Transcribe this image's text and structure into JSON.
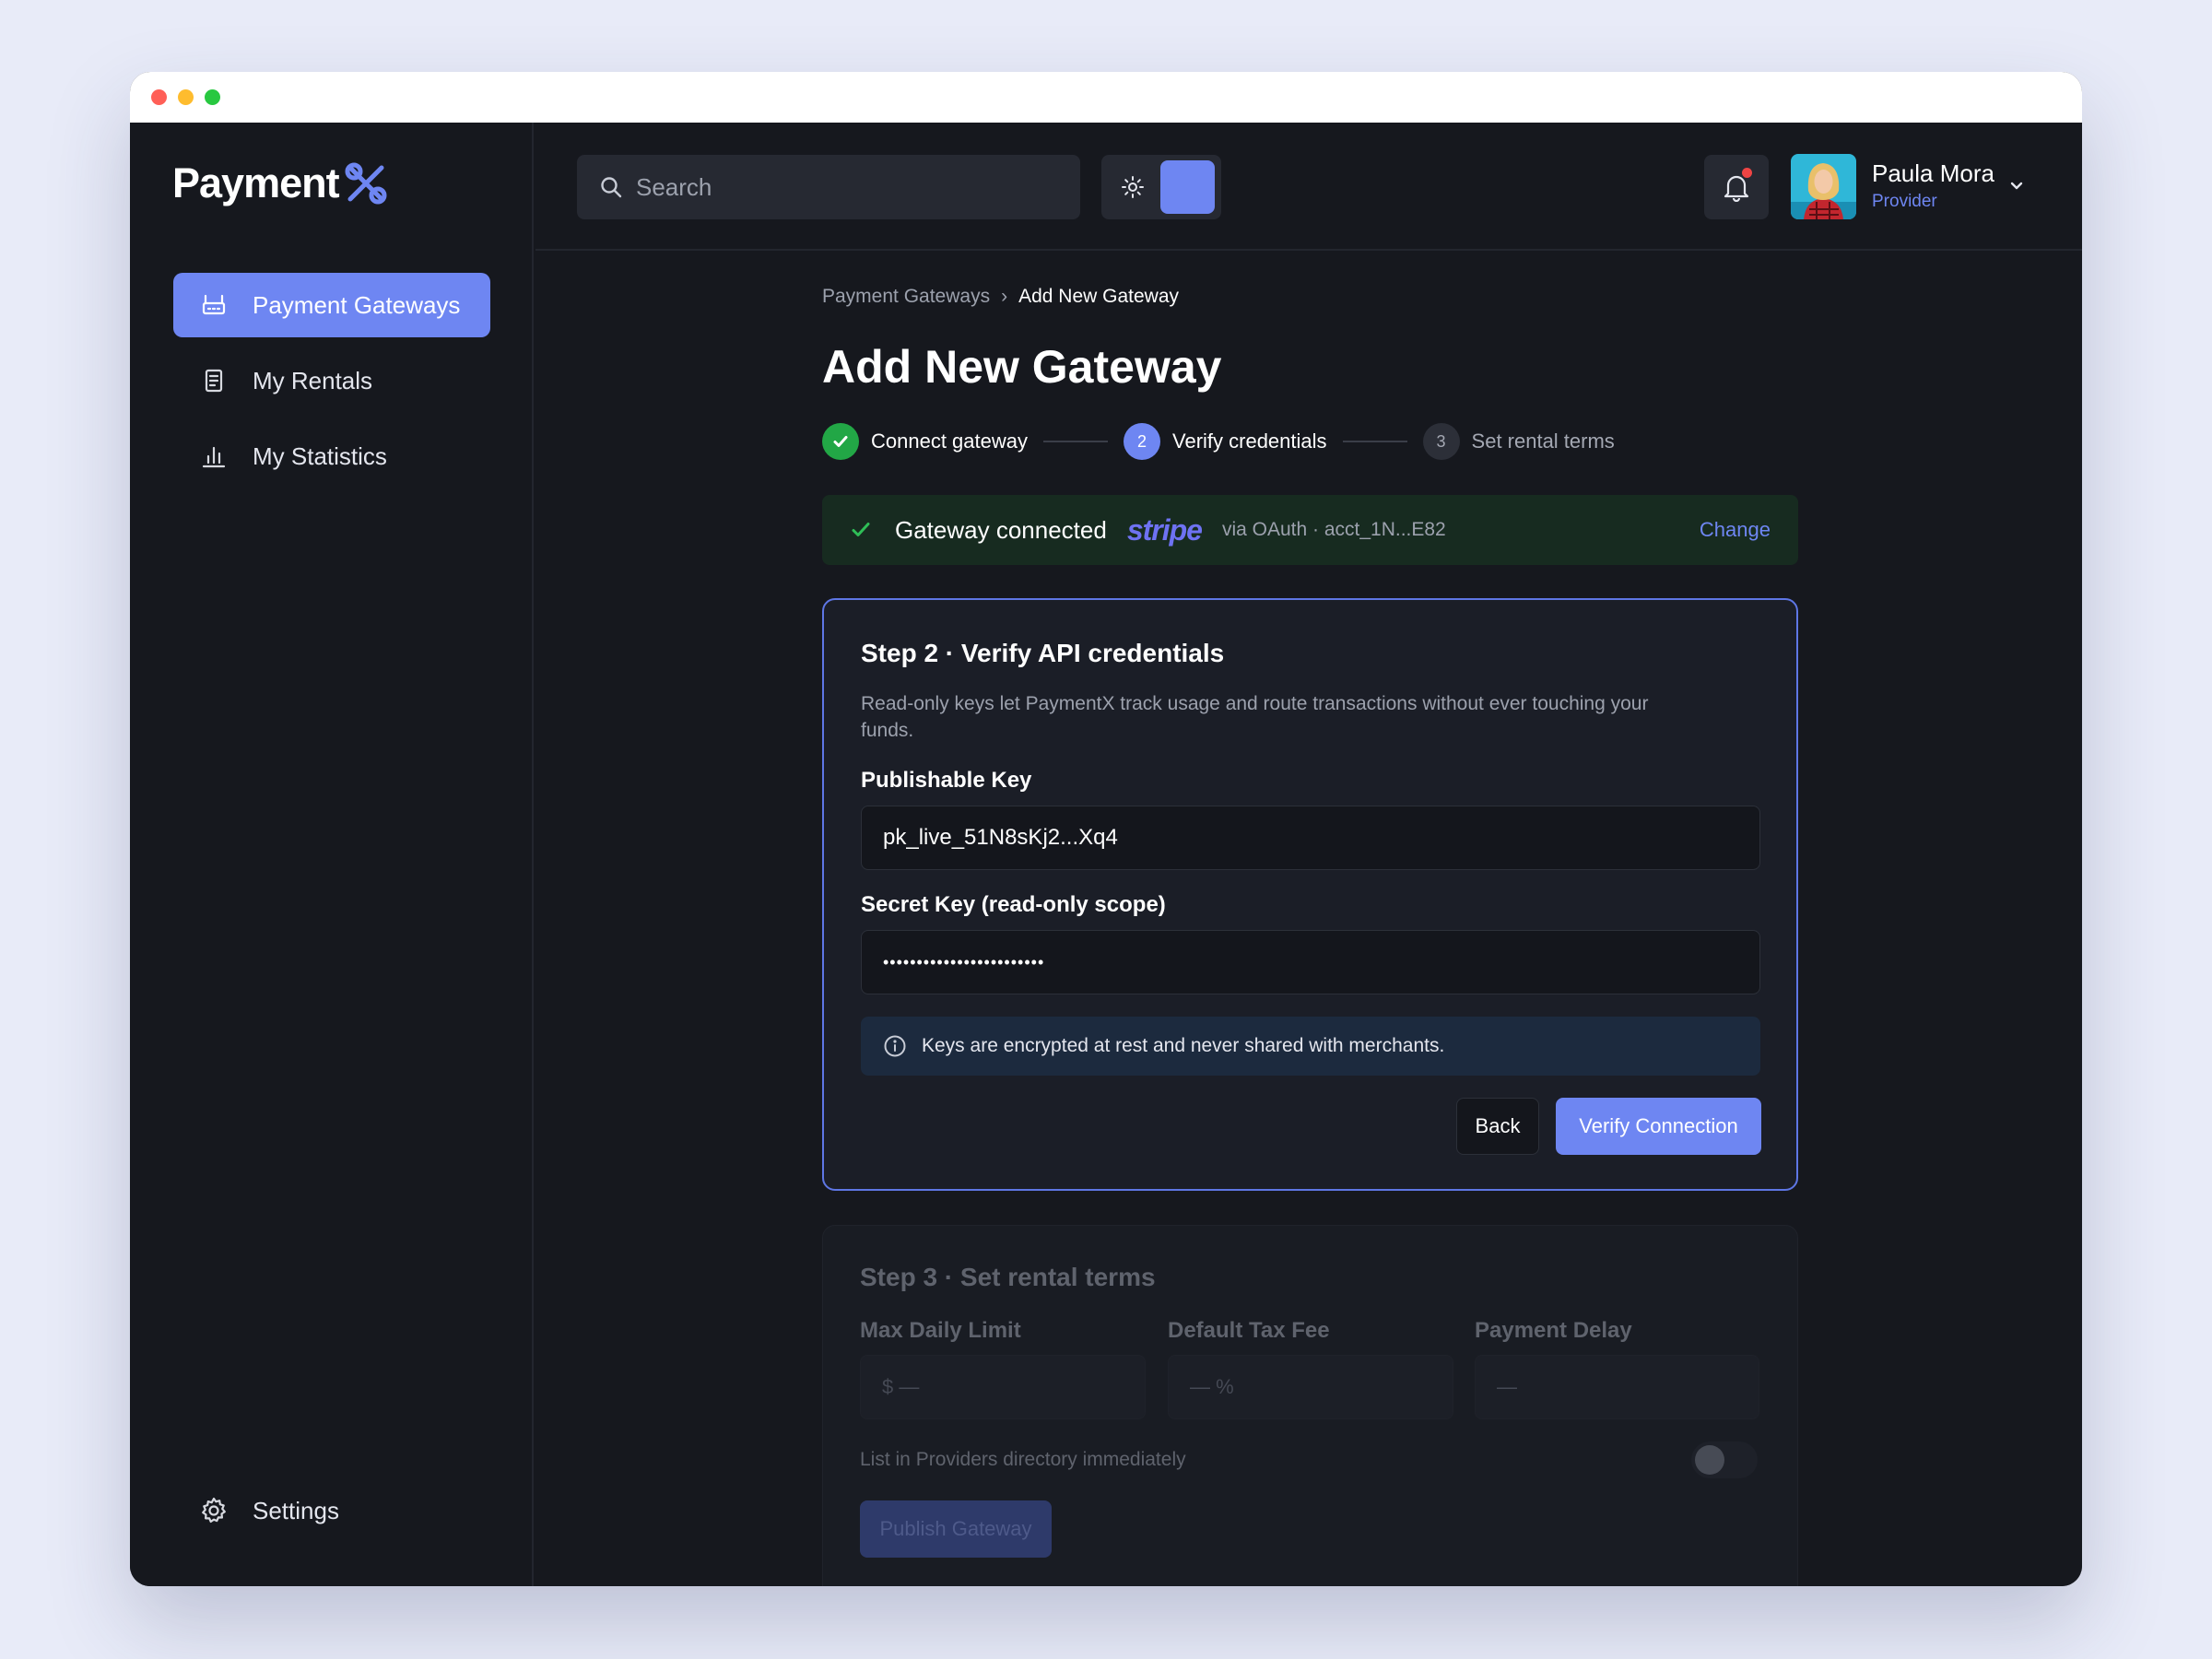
{
  "window": {
    "traffic_lights": {
      "close": "#ff5f57",
      "minimize": "#febc2e",
      "zoom": "#28c840"
    }
  },
  "brand": {
    "name": "Payment",
    "accent": "#6e86f2"
  },
  "sidebar": {
    "items": [
      {
        "label": "Payment Gateways",
        "icon": "gateway-icon",
        "active": true
      },
      {
        "label": "My Rentals",
        "icon": "document-icon",
        "active": false
      },
      {
        "label": "My Statistics",
        "icon": "bar-chart-icon",
        "active": false
      }
    ],
    "settings_label": "Settings"
  },
  "topbar": {
    "search_placeholder": "Search",
    "user": {
      "name": "Paula Mora",
      "role": "Provider"
    }
  },
  "breadcrumb": {
    "parent": "Payment Gateways",
    "separator": "›",
    "current": "Add New Gateway"
  },
  "page_title": "Add New Gateway",
  "stepper": {
    "steps": [
      {
        "number": "1",
        "label": "Connect gateway",
        "status": "done"
      },
      {
        "number": "2",
        "label": "Verify credentials",
        "status": "current"
      },
      {
        "number": "3",
        "label": "Set rental terms",
        "status": "upcoming"
      }
    ]
  },
  "connected_banner": {
    "text": "Gateway connected",
    "provider": "stripe",
    "detail": "via OAuth · acct_1N...E82",
    "change_label": "Change"
  },
  "verify_card": {
    "title": "Step 2 · Verify API credentials",
    "description": "Read-only keys let PaymentX track usage and route transactions without ever touching your funds.",
    "publishable_label": "Publishable Key",
    "publishable_value": "pk_live_51N8sKj2...Xq4",
    "secret_label": "Secret Key (read-only scope)",
    "secret_value": "••••••••••••••••••••••••",
    "info_text": "Keys are encrypted at rest and never shared with merchants.",
    "back_label": "Back",
    "verify_label": "Verify Connection"
  },
  "terms_card": {
    "title": "Step 3 · Set rental terms",
    "max_limit_label": "Max Daily Limit",
    "max_limit_placeholder": "$ —",
    "tax_label": "Default Tax Fee",
    "tax_placeholder": "— %",
    "delay_label": "Payment Delay",
    "delay_placeholder": "—",
    "list_label": "List in Providers directory immediately",
    "list_enabled": false,
    "publish_label": "Publish Gateway"
  }
}
